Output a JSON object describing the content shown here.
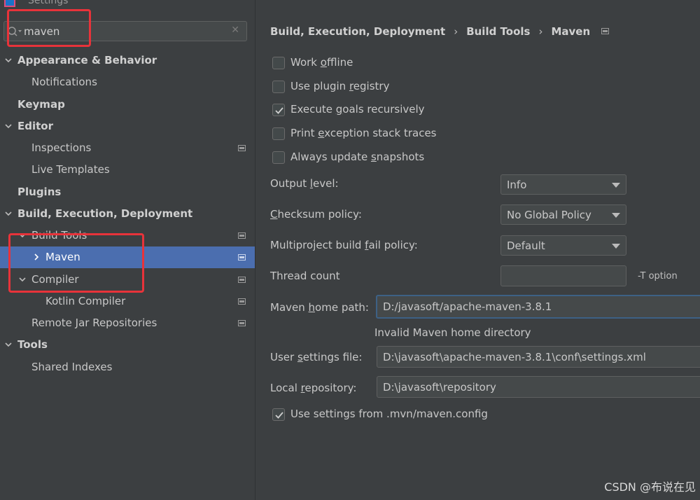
{
  "window": {
    "title": "Settings"
  },
  "search": {
    "value": "maven",
    "clear_icon": "close-icon"
  },
  "tree": [
    {
      "label": "Appearance & Behavior",
      "bold": true,
      "expanded": true
    },
    {
      "label": "Notifications"
    },
    {
      "label": "Keymap",
      "bold": true
    },
    {
      "label": "Editor",
      "bold": true,
      "expanded": true
    },
    {
      "label": "Inspections"
    },
    {
      "label": "Live Templates"
    },
    {
      "label": "Plugins",
      "bold": true
    },
    {
      "label": "Build, Execution, Deployment",
      "bold": true,
      "expanded": true
    },
    {
      "label": "Build Tools",
      "expanded": true
    },
    {
      "label": "Maven",
      "selected": true
    },
    {
      "label": "Compiler",
      "expanded": true
    },
    {
      "label": "Kotlin Compiler"
    },
    {
      "label": "Remote Jar Repositories"
    },
    {
      "label": "Tools",
      "bold": true,
      "expanded": true
    },
    {
      "label": "Shared Indexes"
    }
  ],
  "breadcrumb": {
    "items": [
      "Build, Execution, Deployment",
      "Build Tools",
      "Maven"
    ],
    "separator": "›"
  },
  "options": {
    "work_offline": {
      "label_a": "Work ",
      "label_u": "o",
      "label_b": "ffline",
      "checked": false
    },
    "use_plugin_registry": {
      "label_a": "Use plugin ",
      "label_u": "r",
      "label_b": "egistry",
      "checked": false
    },
    "execute_goals": {
      "label_a": "Execute ",
      "label_u": "g",
      "label_b": "oals recursively",
      "checked": true
    },
    "print_exception": {
      "label_a": "Print ",
      "label_u": "e",
      "label_b": "xception stack traces",
      "checked": false
    },
    "always_update": {
      "label_a": "Always update ",
      "label_u": "s",
      "label_b": "napshots",
      "checked": false
    }
  },
  "output_level": {
    "label_a": "Output ",
    "label_u": "l",
    "label_b": "evel:",
    "value": "Info"
  },
  "checksum_policy": {
    "label_a": "",
    "label_u": "C",
    "label_b": "hecksum policy:",
    "value": "No Global Policy"
  },
  "fail_policy": {
    "label_a": "Multiproject build ",
    "label_u": "f",
    "label_b": "ail policy:",
    "value": "Default"
  },
  "thread_count": {
    "label": "Thread count",
    "value": "",
    "hint": "-T option"
  },
  "maven_home": {
    "label_a": "Maven ",
    "label_u": "h",
    "label_b": "ome path:",
    "value": "D:/javasoft/apache-maven-3.8.1",
    "error": "Invalid Maven home directory"
  },
  "user_settings": {
    "label_a": "User ",
    "label_u": "s",
    "label_b": "ettings file:",
    "value": "D:\\javasoft\\apache-maven-3.8.1\\conf\\settings.xml"
  },
  "local_repo": {
    "label_a": "Local ",
    "label_u": "r",
    "label_b": "epository:",
    "value": "D:\\javasoft\\repository"
  },
  "use_mvn_config": {
    "label": "Use settings from .mvn/maven.config",
    "checked": true
  },
  "watermark": "CSDN @布说在见",
  "colors": {
    "background": "#3c3f41",
    "selection": "#4b6eaf",
    "annotation": "#e8333a"
  }
}
